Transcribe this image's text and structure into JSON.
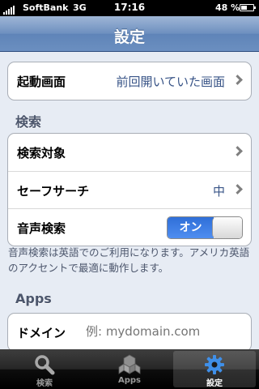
{
  "status_bar": {
    "carrier": "SoftBank",
    "network": "3G",
    "time": "17:16",
    "battery": "48 %"
  },
  "navbar": {
    "title": "設定"
  },
  "startup_group": {
    "label": "起動画面",
    "value": "前回開いていた画面"
  },
  "search_section": {
    "header": "検索",
    "target_label": "検索対象",
    "safesearch_label": "セーフサーチ",
    "safesearch_value": "中",
    "voice_label": "音声検索",
    "voice_toggle": "オン",
    "note": "音声検索は英語でのご利用になります。アメリカ英語のアクセントで最適に動作します。"
  },
  "apps_section": {
    "header": "Apps",
    "domain_label": "ドメイン",
    "domain_placeholder": "例: mydomain.com"
  },
  "tabbar": {
    "tabs": [
      {
        "label": "検索",
        "icon": "magnifier-icon"
      },
      {
        "label": "Apps",
        "icon": "cubes-icon"
      },
      {
        "label": "設定",
        "icon": "gear-icon",
        "selected": true
      }
    ]
  },
  "colors": {
    "navbar": "#6d8fbf",
    "background": "#e7ecf4",
    "value_text": "#385487",
    "toggle_on": "#2f6fd8"
  }
}
